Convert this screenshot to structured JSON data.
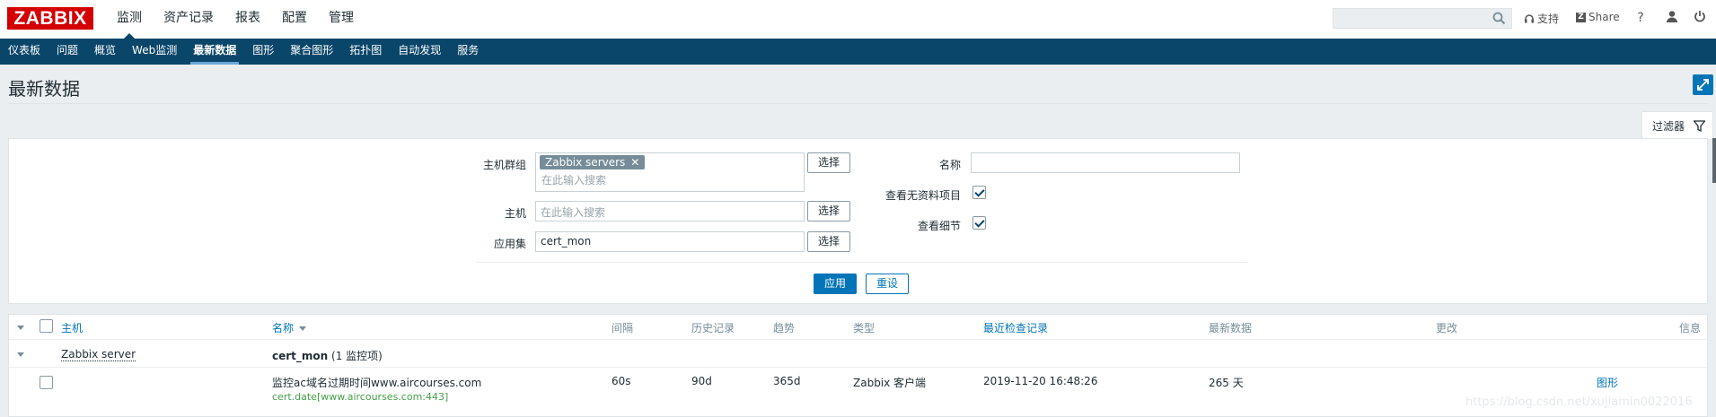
{
  "logo": "ZABBIX",
  "top_nav": [
    {
      "label": "监测",
      "active": true
    },
    {
      "label": "资产记录"
    },
    {
      "label": "报表"
    },
    {
      "label": "配置"
    },
    {
      "label": "管理"
    }
  ],
  "header_right": {
    "support": "支持",
    "share": "Share",
    "help": "?"
  },
  "sub_nav": [
    {
      "label": "仪表板"
    },
    {
      "label": "问题"
    },
    {
      "label": "概览"
    },
    {
      "label": "Web监测"
    },
    {
      "label": "最新数据",
      "active": true
    },
    {
      "label": "图形"
    },
    {
      "label": "聚合图形"
    },
    {
      "label": "拓扑图"
    },
    {
      "label": "自动发现"
    },
    {
      "label": "服务"
    }
  ],
  "page_title": "最新数据",
  "filter_tab": "过滤器",
  "filter": {
    "host_group_label": "主机群组",
    "host_group_chip": "Zabbix servers",
    "host_group_placeholder": "在此输入搜索",
    "host_label": "主机",
    "host_placeholder": "在此输入搜索",
    "app_label": "应用集",
    "app_value": "cert_mon",
    "select_label": "选择",
    "name_label": "名称",
    "name_value": "",
    "show_no_data_label": "查看无资料项目",
    "show_no_data_checked": true,
    "show_details_label": "查看细节",
    "show_details_checked": true,
    "apply_label": "应用",
    "reset_label": "重设"
  },
  "table": {
    "headers": {
      "host": "主机",
      "name": "名称",
      "interval": "间隔",
      "history": "历史记录",
      "trends": "趋势",
      "type": "类型",
      "last_check": "最近检查记录",
      "last_value": "最新数据",
      "change": "更改",
      "info": "信息"
    },
    "group": {
      "host": "Zabbix server",
      "app": "cert_mon",
      "count": "(1 监控项)"
    },
    "rows": [
      {
        "name": "监控ac域名过期时间www.aircourses.com",
        "key": "cert.date[www.aircourses.com:443]",
        "interval": "60s",
        "history": "90d",
        "trends": "365d",
        "type": "Zabbix 客户端",
        "last_check": "2019-11-20 16:48:26",
        "last_value": "265 天",
        "change": "",
        "graph": "图形"
      }
    ]
  },
  "watermark": "https://blog.csdn.net/xujiamin0022016",
  "colors": {
    "brand": "#d40000",
    "nav_bg": "#0a466a",
    "primary": "#0275b8",
    "key_green": "#429e47"
  }
}
